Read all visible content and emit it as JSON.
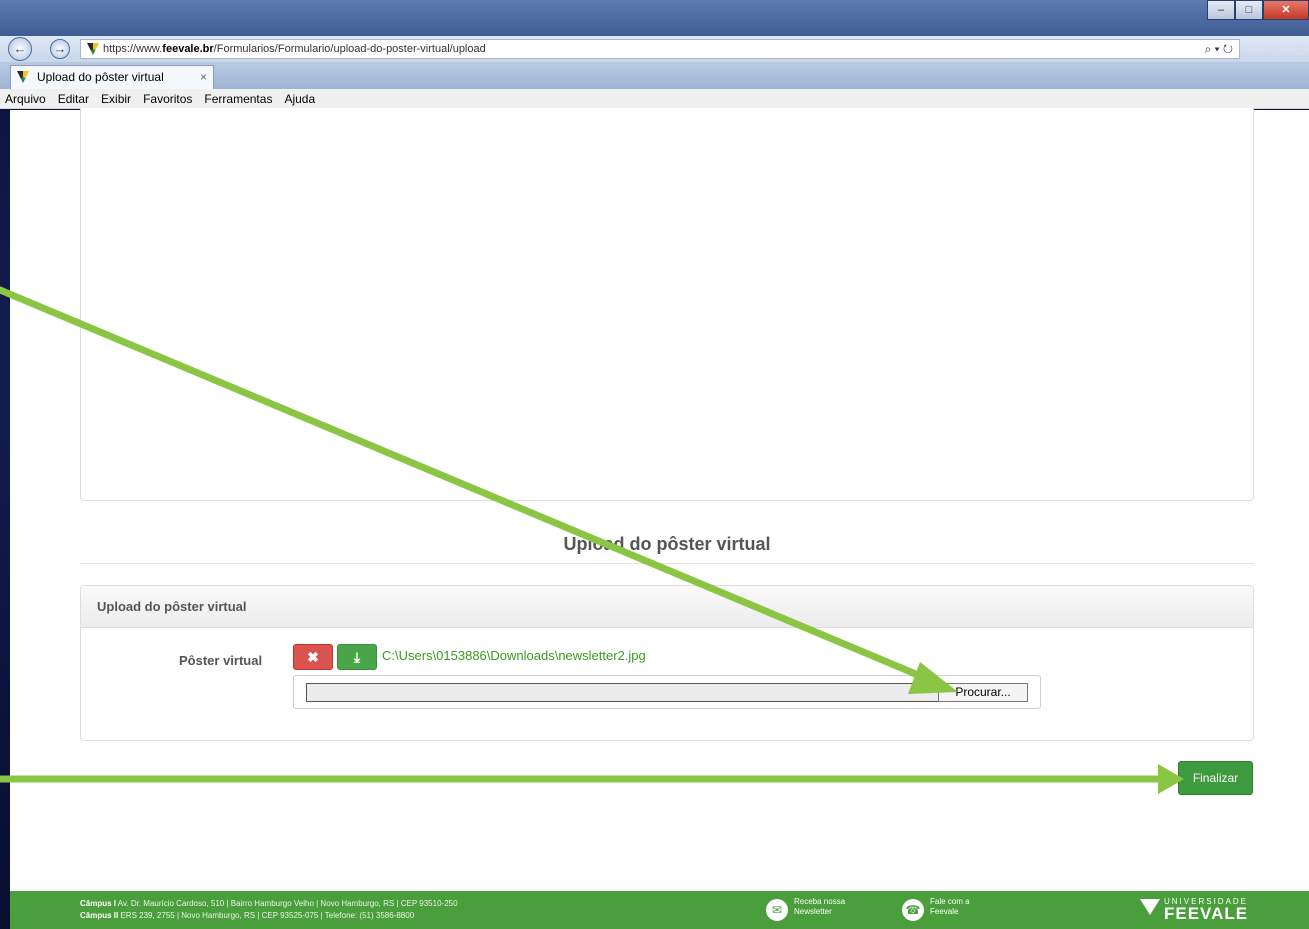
{
  "browser": {
    "url_prefix": "https://www.",
    "url_domain": "feevale.br",
    "url_path": "/Formularios/Formulario/upload-do-poster-virtual/upload",
    "search_refresh": "⌕ ▾ ↻",
    "tab_title": "Upload do pôster virtual",
    "tab_close": "×",
    "back_glyph": "←",
    "forward_glyph": "→",
    "home_glyph": "⌂",
    "star_glyph": "☆",
    "gear_glyph": "⚙",
    "minimize_glyph": "–",
    "maximize_glyph": "□",
    "close_glyph": "✕",
    "menu": [
      "Arquivo",
      "Editar",
      "Exibir",
      "Favoritos",
      "Ferramentas",
      "Ajuda"
    ]
  },
  "page": {
    "section_title": "Upload do pôster virtual",
    "card_title": "Upload do pôster virtual",
    "field_label": "Pôster virtual",
    "remove_glyph": "✖",
    "download_glyph": "⤓",
    "file_path": "C:\\Users\\0153886\\Downloads\\newsletter2.jpg",
    "browse_label": "Procurar...",
    "finalize_label": "Finalizar"
  },
  "footer": {
    "campus1_label": "Câmpus I",
    "campus1_address": " Av. Dr. Maurício Cardoso, 510 | Bairro Hamburgo Velho | Novo Hamburgo, RS | CEP 93510-250",
    "campus2_label": "Câmpus II",
    "campus2_address": " ERS 239, 2755 | Novo Hamburgo, RS | CEP 93525-075 | Telefone: (51) 3586-8800",
    "newsletter_line1": "Receba nossa",
    "newsletter_line2": "Newsletter",
    "contact_line1": "Fale com a",
    "contact_line2": "Feevale",
    "logo_small": "UNIVERSIDADE",
    "logo_big": "FEEVALE",
    "mail_glyph": "✉",
    "headset_glyph": "☎"
  },
  "colors": {
    "accent_green": "#3e9a3e",
    "danger_red": "#d9534f",
    "footer_green": "#4a9e3c",
    "arrow_green": "#8ac543",
    "link_green": "#3a9a1e"
  }
}
